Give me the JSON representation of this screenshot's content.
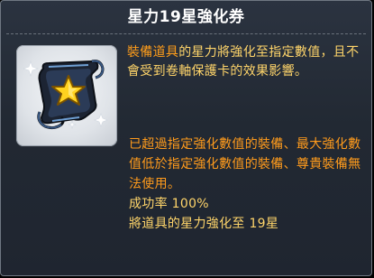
{
  "item": {
    "title": "星力19星強化券",
    "icon": "star-scroll-icon",
    "description_highlight": "裝備道具",
    "description_rest": "的星力將強化至指定數值，且不會受到卷軸保護卡的效果影響。",
    "restriction": "已超過指定強化數值的裝備、最大強化數值低於指定強化數值的裝備、尊貴裝備無法使用。",
    "success_rate": "成功率 100%",
    "effect": "將道具的星力強化至 19星"
  },
  "colors": {
    "title": "#ffffff",
    "description": "#ffd56a",
    "highlight": "#ff9d1a",
    "warning": "#ff9b1c"
  }
}
